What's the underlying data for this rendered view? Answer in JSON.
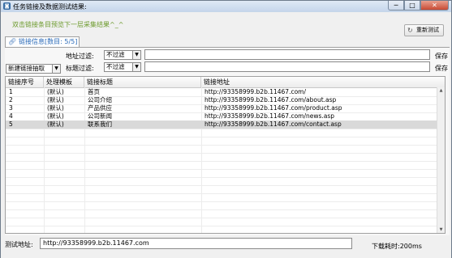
{
  "window": {
    "title": "任务链接及数据测试结果:",
    "controls": {
      "minimize": "─",
      "maximize": "□",
      "close": "✕"
    }
  },
  "hint": "双击链接条目预览下一层采集结果^_^",
  "refresh_button": {
    "label": "重新测试"
  },
  "tab": {
    "label": "链接信息[数目: 5/5]"
  },
  "filters": {
    "address_label": "地址过滤:",
    "address_option": "不过滤",
    "address_value": "",
    "title_label": "标题过滤:",
    "title_option": "不过滤",
    "title_value": "",
    "save_label": "保存",
    "mode_option": "新建链接抽取"
  },
  "table": {
    "columns": [
      "链接序号",
      "处理模板",
      "链接标题",
      "链接地址"
    ],
    "rows": [
      [
        "1",
        "(默认)",
        "首页",
        "http://93358999.b2b.11467.com/"
      ],
      [
        "2",
        "(默认)",
        "公司介绍",
        "http://93358999.b2b.11467.com/about.asp"
      ],
      [
        "3",
        "(默认)",
        "产品供应",
        "http://93358999.b2b.11467.com/product.asp"
      ],
      [
        "4",
        "(默认)",
        "公司新闻",
        "http://93358999.b2b.11467.com/news.asp"
      ],
      [
        "5",
        "(默认)",
        "联系我们",
        "http://93358999.b2b.11467.com/contact.asp"
      ]
    ],
    "selected_index": 4
  },
  "bottom": {
    "test_label": "测试地址:",
    "test_address": "http://93358999.b2b.11467.com",
    "download_time": "下载耗时:200ms"
  },
  "colors": {
    "hint": "#6c9a2c",
    "tab_text": "#2a6ab8",
    "selected_row": "#d9d9d9"
  }
}
